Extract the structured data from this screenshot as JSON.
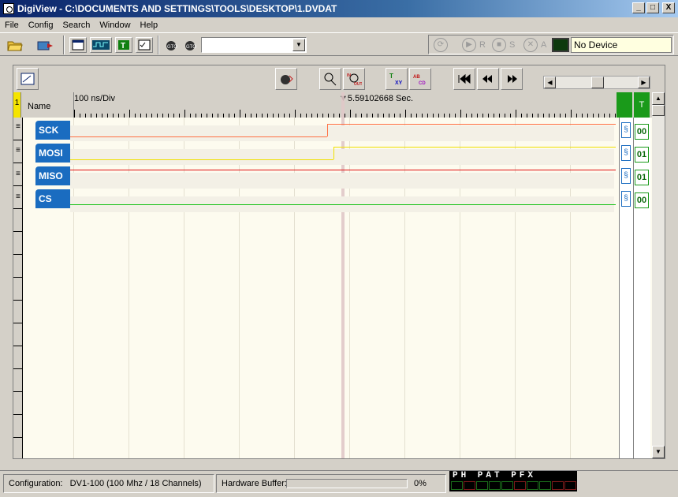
{
  "window": {
    "title": "DigiView - C:\\DOCUMENTS AND SETTINGS\\TOOLS\\DESKTOP\\1.DVDAT",
    "min": "_",
    "max": "□",
    "close": "X"
  },
  "menu": [
    "File",
    "Config",
    "Search",
    "Window",
    "Help"
  ],
  "toolbar": {
    "combo_value": "",
    "controls": {
      "r": "R",
      "s": "S",
      "a": "A"
    },
    "device_status": "No Device"
  },
  "capture": {
    "row_number": "1",
    "name_header": "Name",
    "time_div": "100 ns/Div",
    "cursor_time": "5.59102668 Sec.",
    "value_header": "T",
    "color_buttons": [
      {
        "label": "T",
        "color": "#108010"
      },
      {
        "label": "X",
        "color": "#1010c0"
      },
      {
        "label": "Y",
        "color": "#c01010"
      },
      {
        "label": "A",
        "color": "#c01010"
      },
      {
        "label": "B",
        "color": "#c0a000"
      },
      {
        "label": "C",
        "color": "#1010c0"
      },
      {
        "label": "D",
        "color": "#a010c0"
      }
    ],
    "subtoolbar": {
      "xy": "XY",
      "abcd": "AB CD",
      "in_out": "IN OUT"
    }
  },
  "channels": [
    {
      "name": "SCK",
      "value": "00",
      "color": "#ff7043"
    },
    {
      "name": "MOSI",
      "value": "01",
      "color": "#f0e000"
    },
    {
      "name": "MISO",
      "value": "01",
      "color": "#e01010"
    },
    {
      "name": "CS",
      "value": "00",
      "color": "#10c010"
    }
  ],
  "status": {
    "configuration_label": "Configuration:",
    "configuration_value": "DV1-100 (100 Mhz / 18 Channels)",
    "buffer_label": "Hardware Buffer:",
    "buffer_percent": "0%",
    "buffer_fill": 0,
    "leds_letters": "PH PAT PFX"
  }
}
